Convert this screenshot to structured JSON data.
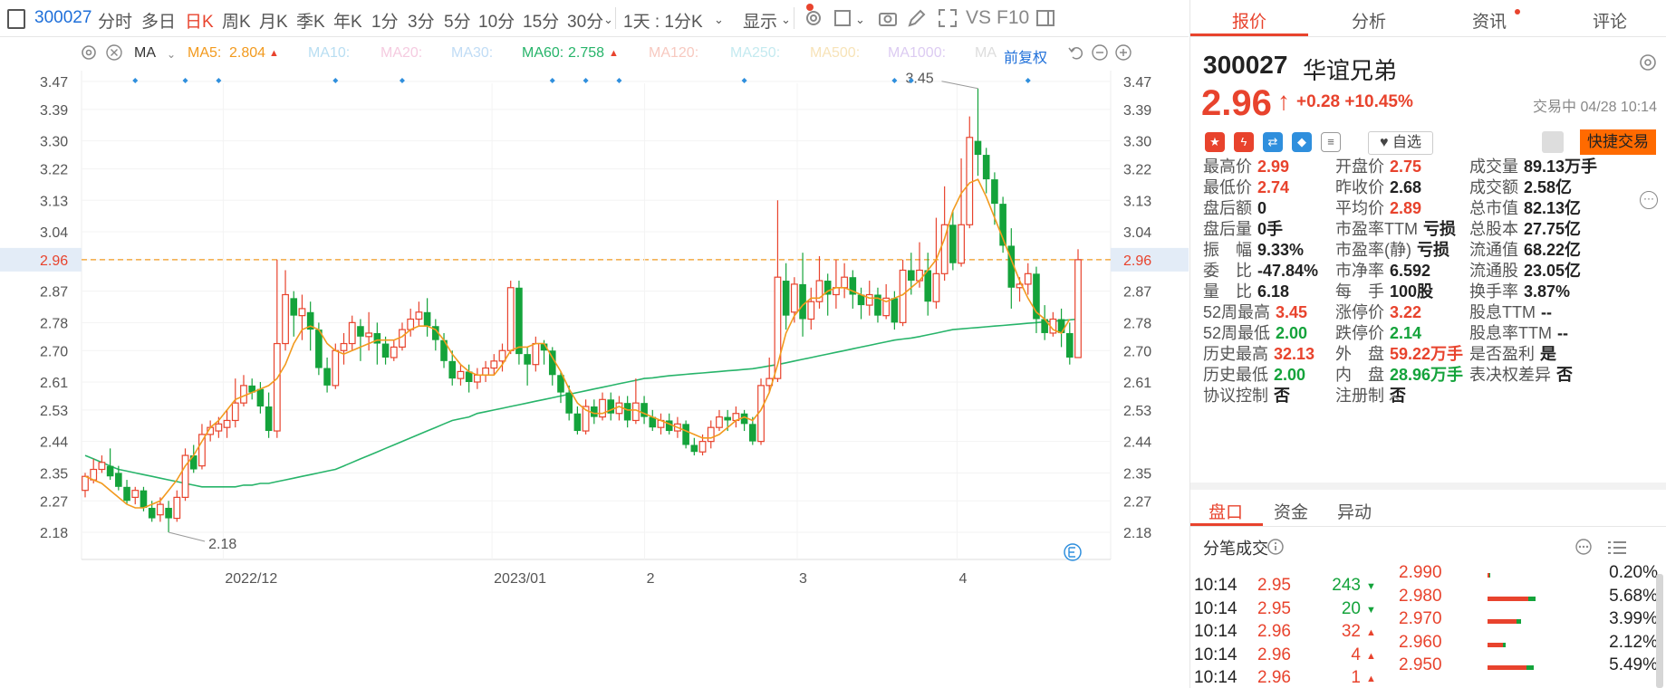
{
  "toolbar": {
    "code": "300027",
    "periods": [
      "分时",
      "多日",
      "日K",
      "周K",
      "月K",
      "季K",
      "年K",
      "1分",
      "3分",
      "5分",
      "10分",
      "15分",
      "30分"
    ],
    "active_period": "日K",
    "range_select": "1天 : 1分K",
    "display": "显示",
    "vs": "VS",
    "f10": "F10"
  },
  "indicators": {
    "ma_type": "MA",
    "ma5_label": "MA5:",
    "ma5_value": "2.804",
    "ma10": "MA10:",
    "ma20": "MA20:",
    "ma30": "MA30:",
    "ma60_label": "MA60:",
    "ma60_value": "2.758",
    "ma120": "MA120:",
    "ma250": "MA250:",
    "ma500": "MA500:",
    "ma1000": "MA1000:",
    "ma_cut": "MA",
    "adjust": "前复权"
  },
  "chart_data": {
    "type": "candlestick",
    "y_ticks": [
      "3.47",
      "3.39",
      "3.30",
      "3.22",
      "3.13",
      "3.04",
      "2.96",
      "2.87",
      "2.78",
      "2.70",
      "2.61",
      "2.53",
      "2.44",
      "2.35",
      "2.27",
      "2.18"
    ],
    "ylim": [
      2.14,
      3.5
    ],
    "x_ticks": [
      "2022/12",
      "2023/01",
      "2",
      "3",
      "4"
    ],
    "current_price_label": "2.96",
    "high_marker": "3.45",
    "low_marker": "2.18",
    "series_colors": {
      "up": "#e8432d",
      "down": "#14a33b",
      "ma5": "#f29a1e",
      "ma60": "#27b46a"
    },
    "candles": [
      [
        2.3,
        2.34,
        2.28,
        2.35
      ],
      [
        2.33,
        2.36,
        2.32,
        2.39
      ],
      [
        2.36,
        2.38,
        2.35,
        2.4
      ],
      [
        2.37,
        2.34,
        2.33,
        2.42
      ],
      [
        2.35,
        2.31,
        2.3,
        2.37
      ],
      [
        2.31,
        2.27,
        2.26,
        2.33
      ],
      [
        2.28,
        2.3,
        2.26,
        2.31
      ],
      [
        2.3,
        2.25,
        2.24,
        2.31
      ],
      [
        2.25,
        2.22,
        2.21,
        2.27
      ],
      [
        2.23,
        2.26,
        2.21,
        2.28
      ],
      [
        2.25,
        2.22,
        2.18,
        2.27
      ],
      [
        2.22,
        2.28,
        2.21,
        2.3
      ],
      [
        2.28,
        2.4,
        2.27,
        2.42
      ],
      [
        2.4,
        2.36,
        2.35,
        2.43
      ],
      [
        2.37,
        2.46,
        2.36,
        2.49
      ],
      [
        2.46,
        2.48,
        2.44,
        2.5
      ],
      [
        2.47,
        2.49,
        2.45,
        2.51
      ],
      [
        2.48,
        2.5,
        2.45,
        2.53
      ],
      [
        2.5,
        2.55,
        2.48,
        2.62
      ],
      [
        2.55,
        2.6,
        2.54,
        2.63
      ],
      [
        2.6,
        2.58,
        2.56,
        2.62
      ],
      [
        2.59,
        2.54,
        2.52,
        2.61
      ],
      [
        2.54,
        2.47,
        2.45,
        2.58
      ],
      [
        2.47,
        2.72,
        2.45,
        2.96
      ],
      [
        2.72,
        2.86,
        2.7,
        2.93
      ],
      [
        2.85,
        2.8,
        2.74,
        2.87
      ],
      [
        2.8,
        2.82,
        2.73,
        2.86
      ],
      [
        2.81,
        2.76,
        2.7,
        2.84
      ],
      [
        2.76,
        2.65,
        2.63,
        2.78
      ],
      [
        2.65,
        2.6,
        2.58,
        2.68
      ],
      [
        2.6,
        2.7,
        2.59,
        2.72
      ],
      [
        2.7,
        2.72,
        2.66,
        2.75
      ],
      [
        2.72,
        2.78,
        2.7,
        2.8
      ],
      [
        2.77,
        2.74,
        2.67,
        2.79
      ],
      [
        2.74,
        2.75,
        2.7,
        2.81
      ],
      [
        2.75,
        2.72,
        2.66,
        2.78
      ],
      [
        2.72,
        2.68,
        2.66,
        2.74
      ],
      [
        2.68,
        2.71,
        2.67,
        2.73
      ],
      [
        2.71,
        2.76,
        2.7,
        2.78
      ],
      [
        2.76,
        2.79,
        2.74,
        2.82
      ],
      [
        2.79,
        2.81,
        2.77,
        2.84
      ],
      [
        2.81,
        2.77,
        2.74,
        2.85
      ],
      [
        2.77,
        2.73,
        2.7,
        2.79
      ],
      [
        2.73,
        2.67,
        2.65,
        2.75
      ],
      [
        2.67,
        2.62,
        2.6,
        2.7
      ],
      [
        2.62,
        2.64,
        2.6,
        2.66
      ],
      [
        2.64,
        2.61,
        2.58,
        2.66
      ],
      [
        2.61,
        2.63,
        2.59,
        2.65
      ],
      [
        2.63,
        2.65,
        2.61,
        2.67
      ],
      [
        2.65,
        2.67,
        2.63,
        2.69
      ],
      [
        2.67,
        2.7,
        2.64,
        2.72
      ],
      [
        2.7,
        2.88,
        2.69,
        2.9
      ],
      [
        2.88,
        2.69,
        2.66,
        2.9
      ],
      [
        2.69,
        2.66,
        2.6,
        2.71
      ],
      [
        2.66,
        2.72,
        2.64,
        2.74
      ],
      [
        2.72,
        2.7,
        2.66,
        2.73
      ],
      [
        2.7,
        2.63,
        2.6,
        2.71
      ],
      [
        2.63,
        2.58,
        2.55,
        2.64
      ],
      [
        2.58,
        2.52,
        2.5,
        2.6
      ],
      [
        2.52,
        2.47,
        2.46,
        2.54
      ],
      [
        2.47,
        2.54,
        2.46,
        2.56
      ],
      [
        2.54,
        2.51,
        2.49,
        2.56
      ],
      [
        2.51,
        2.56,
        2.5,
        2.58
      ],
      [
        2.56,
        2.52,
        2.5,
        2.58
      ],
      [
        2.52,
        2.55,
        2.5,
        2.57
      ],
      [
        2.55,
        2.5,
        2.48,
        2.57
      ],
      [
        2.5,
        2.55,
        2.49,
        2.62
      ],
      [
        2.55,
        2.51,
        2.49,
        2.57
      ],
      [
        2.51,
        2.48,
        2.47,
        2.53
      ],
      [
        2.48,
        2.5,
        2.46,
        2.52
      ],
      [
        2.5,
        2.47,
        2.46,
        2.52
      ],
      [
        2.47,
        2.49,
        2.45,
        2.51
      ],
      [
        2.49,
        2.43,
        2.42,
        2.5
      ],
      [
        2.43,
        2.41,
        2.4,
        2.45
      ],
      [
        2.41,
        2.44,
        2.4,
        2.46
      ],
      [
        2.44,
        2.48,
        2.42,
        2.5
      ],
      [
        2.48,
        2.51,
        2.47,
        2.53
      ],
      [
        2.51,
        2.5,
        2.47,
        2.53
      ],
      [
        2.5,
        2.52,
        2.48,
        2.54
      ],
      [
        2.52,
        2.49,
        2.47,
        2.53
      ],
      [
        2.49,
        2.44,
        2.43,
        2.51
      ],
      [
        2.44,
        2.6,
        2.43,
        2.62
      ],
      [
        2.6,
        2.62,
        2.58,
        2.68
      ],
      [
        2.62,
        2.91,
        2.61,
        3.13
      ],
      [
        2.9,
        2.8,
        2.76,
        2.95
      ],
      [
        2.81,
        2.89,
        2.78,
        2.91
      ],
      [
        2.89,
        2.79,
        2.74,
        2.98
      ],
      [
        2.79,
        2.84,
        2.76,
        2.88
      ],
      [
        2.84,
        2.9,
        2.82,
        2.97
      ],
      [
        2.9,
        2.86,
        2.8,
        2.92
      ],
      [
        2.86,
        2.88,
        2.82,
        2.96
      ],
      [
        2.88,
        2.91,
        2.85,
        2.95
      ],
      [
        2.91,
        2.86,
        2.82,
        2.93
      ],
      [
        2.86,
        2.83,
        2.79,
        2.88
      ],
      [
        2.83,
        2.86,
        2.8,
        2.9
      ],
      [
        2.86,
        2.8,
        2.78,
        2.88
      ],
      [
        2.8,
        2.85,
        2.79,
        2.89
      ],
      [
        2.85,
        2.78,
        2.76,
        2.87
      ],
      [
        2.78,
        2.93,
        2.77,
        2.96
      ],
      [
        2.93,
        2.9,
        2.86,
        2.98
      ],
      [
        2.9,
        2.93,
        2.88,
        3.01
      ],
      [
        2.93,
        2.84,
        2.8,
        2.98
      ],
      [
        2.84,
        2.92,
        2.82,
        3.08
      ],
      [
        2.92,
        3.06,
        2.9,
        3.17
      ],
      [
        3.06,
        2.95,
        2.93,
        3.1
      ],
      [
        2.95,
        3.06,
        2.94,
        3.25
      ],
      [
        3.06,
        3.31,
        3.05,
        3.37
      ],
      [
        3.3,
        3.26,
        3.2,
        3.45
      ],
      [
        3.26,
        3.19,
        3.15,
        3.28
      ],
      [
        3.19,
        3.12,
        3.06,
        3.21
      ],
      [
        3.12,
        3.0,
        2.98,
        3.14
      ],
      [
        3.0,
        2.88,
        2.82,
        3.05
      ],
      [
        2.88,
        2.89,
        2.84,
        2.91
      ],
      [
        2.89,
        2.92,
        2.86,
        2.95
      ],
      [
        2.92,
        2.79,
        2.75,
        2.94
      ],
      [
        2.79,
        2.75,
        2.73,
        2.83
      ],
      [
        2.75,
        2.79,
        2.74,
        2.81
      ],
      [
        2.79,
        2.75,
        2.71,
        2.82
      ],
      [
        2.75,
        2.68,
        2.66,
        2.78
      ],
      [
        2.68,
        2.96,
        2.74,
        2.99
      ]
    ],
    "ma5": [
      2.34,
      2.33,
      2.32,
      2.3,
      2.28,
      2.26,
      2.25,
      2.25,
      2.26,
      2.27,
      2.3,
      2.33,
      2.37,
      2.4,
      2.44,
      2.48,
      2.5,
      2.53,
      2.56,
      2.57,
      2.58,
      2.59,
      2.6,
      2.62,
      2.66,
      2.72,
      2.76,
      2.77,
      2.76,
      2.72,
      2.7,
      2.69,
      2.7,
      2.71,
      2.72,
      2.73,
      2.73,
      2.73,
      2.74,
      2.76,
      2.77,
      2.77,
      2.76,
      2.73,
      2.69,
      2.66,
      2.64,
      2.63,
      2.63,
      2.63,
      2.66,
      2.7,
      2.71,
      2.71,
      2.72,
      2.72,
      2.68,
      2.64,
      2.59,
      2.55,
      2.53,
      2.52,
      2.52,
      2.53,
      2.54,
      2.53,
      2.53,
      2.52,
      2.51,
      2.5,
      2.49,
      2.48,
      2.47,
      2.46,
      2.45,
      2.45,
      2.46,
      2.48,
      2.5,
      2.51,
      2.5,
      2.53,
      2.58,
      2.66,
      2.75,
      2.8,
      2.83,
      2.85,
      2.85,
      2.87,
      2.88,
      2.88,
      2.87,
      2.86,
      2.85,
      2.85,
      2.84,
      2.85,
      2.86,
      2.88,
      2.9,
      2.93,
      2.96,
      3.02,
      3.1,
      3.15,
      3.18,
      3.19,
      3.14,
      3.08,
      3.02,
      2.96,
      2.9,
      2.85,
      2.81,
      2.79,
      2.76,
      2.75,
      2.79
    ],
    "ma60": [
      2.4,
      2.39,
      2.38,
      2.37,
      2.36,
      2.355,
      2.35,
      2.345,
      2.34,
      2.335,
      2.33,
      2.325,
      2.32,
      2.315,
      2.31,
      2.31,
      2.31,
      2.31,
      2.31,
      2.315,
      2.315,
      2.32,
      2.32,
      2.325,
      2.33,
      2.335,
      2.34,
      2.345,
      2.35,
      2.355,
      2.36,
      2.37,
      2.38,
      2.39,
      2.4,
      2.41,
      2.42,
      2.43,
      2.44,
      2.45,
      2.46,
      2.47,
      2.48,
      2.49,
      2.5,
      2.505,
      2.51,
      2.52,
      2.525,
      2.53,
      2.535,
      2.54,
      2.545,
      2.55,
      2.555,
      2.56,
      2.565,
      2.57,
      2.575,
      2.58,
      2.585,
      2.59,
      2.595,
      2.6,
      2.605,
      2.61,
      2.615,
      2.62,
      2.622,
      2.625,
      2.628,
      2.63,
      2.632,
      2.634,
      2.636,
      2.638,
      2.64,
      2.642,
      2.644,
      2.646,
      2.648,
      2.652,
      2.656,
      2.66,
      2.665,
      2.67,
      2.675,
      2.68,
      2.685,
      2.69,
      2.695,
      2.7,
      2.705,
      2.71,
      2.715,
      2.72,
      2.725,
      2.73,
      2.733,
      2.736,
      2.74,
      2.745,
      2.75,
      2.755,
      2.76,
      2.762,
      2.764,
      2.766,
      2.768,
      2.77,
      2.772,
      2.774,
      2.776,
      2.778,
      2.78,
      2.782,
      2.784,
      2.786,
      2.788,
      2.79
    ]
  },
  "panel": {
    "tabs": [
      "报价",
      "分析",
      "资讯",
      "评论"
    ],
    "code": "300027",
    "name": "华谊兄弟",
    "price": "2.96",
    "arrow": "↑",
    "change": "+0.28",
    "change_pct": "+10.45%",
    "status": "交易中 04/28 10:14",
    "zixuan": "自选",
    "quick_trade": "快捷交易",
    "fields_col1": [
      {
        "label": "最高价",
        "value": "2.99",
        "color": "red"
      },
      {
        "label": "最低价",
        "value": "2.74",
        "color": "red"
      },
      {
        "label": "盘后额",
        "value": "0",
        "color": "blk"
      },
      {
        "label": "盘后量",
        "value": "0手",
        "color": "blk"
      },
      {
        "label": "振　幅",
        "value": "9.33%",
        "color": "blk"
      },
      {
        "label": "委　比",
        "value": "-47.84%",
        "color": "blk"
      },
      {
        "label": "量　比",
        "value": "6.18",
        "color": "blk"
      },
      {
        "label": "52周最高",
        "value": "3.45",
        "color": "red"
      },
      {
        "label": "52周最低",
        "value": "2.00",
        "color": "green"
      },
      {
        "label": "历史最高",
        "value": "32.13",
        "color": "red"
      },
      {
        "label": "历史最低",
        "value": "2.00",
        "color": "green"
      },
      {
        "label": "协议控制",
        "value": "否",
        "color": "blk"
      }
    ],
    "fields_col2": [
      {
        "label": "开盘价",
        "value": "2.75",
        "color": "red"
      },
      {
        "label": "昨收价",
        "value": "2.68",
        "color": "blk"
      },
      {
        "label": "平均价",
        "value": "2.89",
        "color": "red"
      },
      {
        "label": "市盈率TTM",
        "value": "亏损",
        "color": "blk"
      },
      {
        "label": "市盈率(静)",
        "value": "亏损",
        "color": "blk"
      },
      {
        "label": "市净率",
        "value": "6.592",
        "color": "blk"
      },
      {
        "label": "每　手",
        "value": "100股",
        "color": "blk"
      },
      {
        "label": "涨停价",
        "value": "3.22",
        "color": "red"
      },
      {
        "label": "跌停价",
        "value": "2.14",
        "color": "green"
      },
      {
        "label": "外　盘",
        "value": "59.22万手",
        "color": "red"
      },
      {
        "label": "内　盘",
        "value": "28.96万手",
        "color": "green"
      },
      {
        "label": "注册制",
        "value": "否",
        "color": "blk"
      }
    ],
    "fields_col3": [
      {
        "label": "成交量",
        "value": "89.13万手",
        "color": "blk"
      },
      {
        "label": "成交额",
        "value": "2.58亿",
        "color": "blk"
      },
      {
        "label": "总市值",
        "value": "82.13亿",
        "color": "blk"
      },
      {
        "label": "总股本",
        "value": "27.75亿",
        "color": "blk"
      },
      {
        "label": "流通值",
        "value": "68.22亿",
        "color": "blk"
      },
      {
        "label": "流通股",
        "value": "23.05亿",
        "color": "blk"
      },
      {
        "label": "换手率",
        "value": "3.87%",
        "color": "blk"
      },
      {
        "label": "股息TTM",
        "value": "--",
        "color": "blk"
      },
      {
        "label": "股息率TTM",
        "value": "--",
        "color": "blk"
      },
      {
        "label": "是否盈利",
        "value": "是",
        "color": "blk"
      },
      {
        "label": "表决权差异",
        "value": "否",
        "color": "blk"
      }
    ],
    "subtabs": [
      "盘口",
      "资金",
      "异动"
    ],
    "fenbi_title": "分笔成交",
    "trades": [
      {
        "time": "10:14",
        "price": "2.95",
        "vol": "243",
        "dir": "down"
      },
      {
        "time": "10:14",
        "price": "2.95",
        "vol": "20",
        "dir": "down"
      },
      {
        "time": "10:14",
        "price": "2.96",
        "vol": "32",
        "dir": "up"
      },
      {
        "time": "10:14",
        "price": "2.96",
        "vol": "4",
        "dir": "up"
      },
      {
        "time": "10:14",
        "price": "2.96",
        "vol": "1",
        "dir": "up"
      }
    ],
    "depth": [
      {
        "price": "2.990",
        "pct": "0.20%",
        "frac": 0.02
      },
      {
        "price": "2.980",
        "pct": "5.68%",
        "frac": 0.55
      },
      {
        "price": "2.970",
        "pct": "3.99%",
        "frac": 0.39
      },
      {
        "price": "2.960",
        "pct": "2.12%",
        "frac": 0.21
      },
      {
        "price": "2.950",
        "pct": "5.49%",
        "frac": 0.53
      }
    ]
  }
}
